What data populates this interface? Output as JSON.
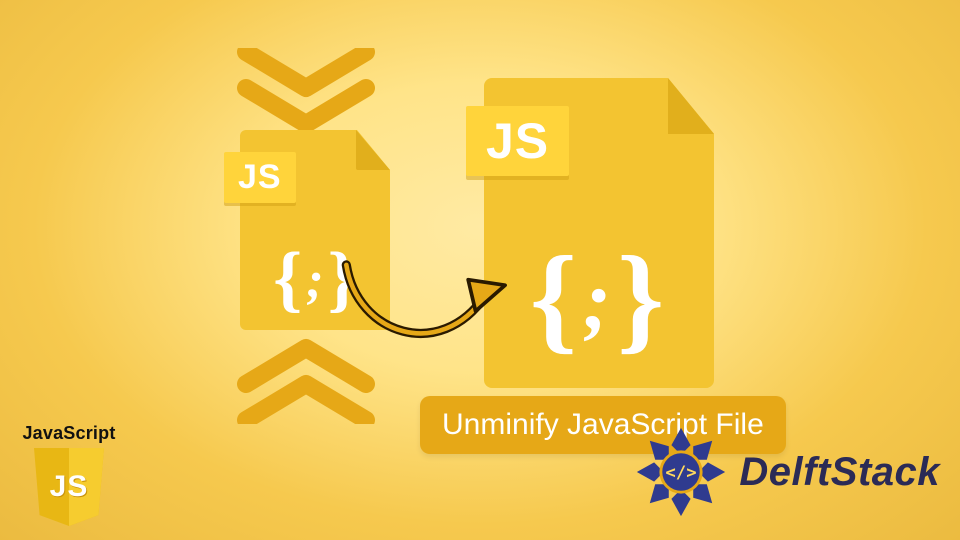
{
  "colors": {
    "bg_center": "#ffe799",
    "bg_edge": "#e9b83d",
    "file_fill": "#f3c431",
    "file_fold": "#e1af1c",
    "badge_fill": "#ffd43b",
    "accent": "#e6a817",
    "arrow_stroke": "#2a1a00",
    "delft_blue": "#2f3b8f",
    "delft_text": "#2b2b56"
  },
  "small_file": {
    "badge": "JS",
    "brace_open": "{",
    "brace_close": "}",
    "semi": ";"
  },
  "large_file": {
    "badge": "JS",
    "brace_open": "{",
    "brace_close": "}",
    "semi": ";"
  },
  "caption": "Unminify JavaScript File",
  "logo_js": {
    "label": "JavaScript",
    "shield_text": "JS"
  },
  "logo_delft": {
    "text": "DelftStack",
    "glyph": "</>"
  }
}
